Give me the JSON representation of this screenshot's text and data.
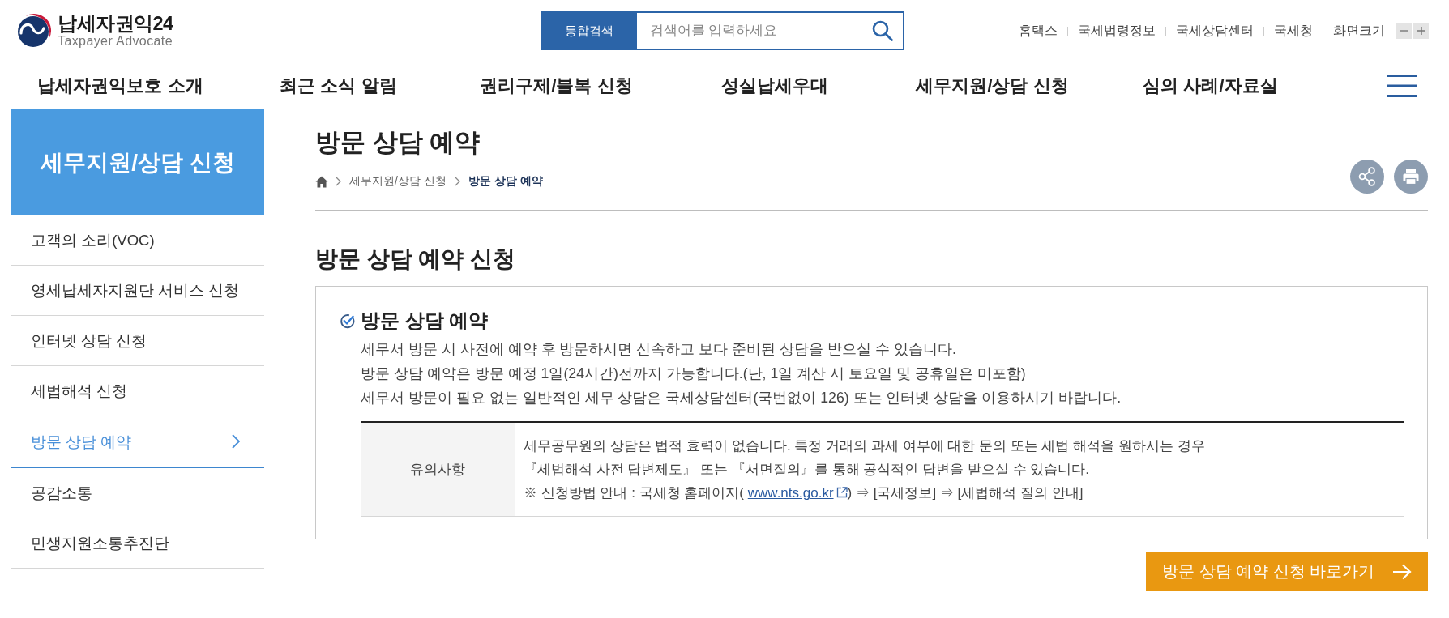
{
  "header": {
    "logo": {
      "title": "납세자권익24",
      "subtitle": "Taxpayer Advocate"
    },
    "search": {
      "scope": "통합검색",
      "placeholder": "검색어를 입력하세요"
    },
    "utility_links": [
      "홈택스",
      "국세법령정보",
      "국세상담센터",
      "국세청"
    ],
    "screen_size": {
      "label": "화면크기"
    }
  },
  "nav": {
    "items": [
      "납세자권익보호 소개",
      "최근 소식 알림",
      "권리구제/불복 신청",
      "성실납세우대",
      "세무지원/상담 신청",
      "심의 사례/자료실"
    ]
  },
  "sidebar": {
    "title": "세무지원/상담 신청",
    "items": [
      {
        "label": "고객의 소리(VOC)",
        "selected": false
      },
      {
        "label": "영세납세자지원단 서비스 신청",
        "selected": false
      },
      {
        "label": "인터넷 상담 신청",
        "selected": false
      },
      {
        "label": "세법해석 신청",
        "selected": false
      },
      {
        "label": "방문 상담 예약",
        "selected": true
      },
      {
        "label": "공감소통",
        "selected": false
      },
      {
        "label": "민생지원소통추진단",
        "selected": false
      }
    ]
  },
  "page": {
    "title": "방문 상담 예약",
    "breadcrumb": [
      "세무지원/상담 신청",
      "방문 상담 예약"
    ]
  },
  "section": {
    "title": "방문 상담 예약 신청",
    "box": {
      "title": "방문 상담 예약",
      "lines": [
        "세무서 방문 시 사전에 예약 후 방문하시면 신속하고 보다 준비된 상담을 받으실 수 있습니다.",
        "방문 상담 예약은 방문 예정 1일(24시간)전까지 가능합니다.(단, 1일 계산 시 토요일 및 공휴일은 미포함)",
        "세무서 방문이 필요 없는 일반적인 세무 상담은 국세상담센터(국번없이 126) 또는 인터넷 상담을 이용하시기 바랍니다."
      ],
      "notice": {
        "label": "유의사항",
        "lines": [
          {
            "kind": "text",
            "text": "세무공무원의 상담은 법적 효력이 없습니다. 특정 거래의 과세 여부에 대한 문의 또는 세법 해석을 원하시는 경우"
          },
          {
            "kind": "text",
            "text": "『세법해석 사전 답변제도』 또는 『서면질의』를 통해 공식적인 답변을 받으실 수 있습니다."
          },
          {
            "kind": "link",
            "before": "※ 신청방법 안내 : 국세청 홈페이지( ",
            "link": "www.nts.go.kr",
            "after": ") ⇒ [국세정보] ⇒ [세법해석 질의 안내]"
          }
        ]
      }
    }
  },
  "cta": {
    "label": "방문 상담 예약 신청 바로가기"
  }
}
